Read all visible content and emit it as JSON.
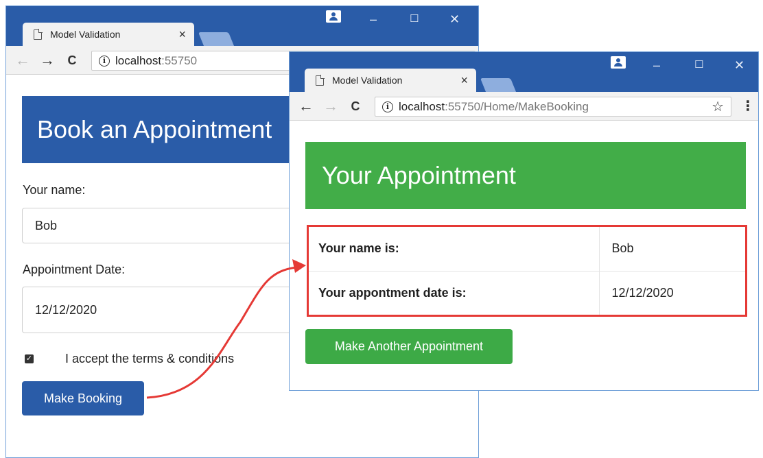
{
  "back_window": {
    "tab_title": "Model Validation",
    "tab_close": "×",
    "url_host": "localhost",
    "url_path": ":55750",
    "controls": {
      "minimize": "–",
      "maximize": "☐",
      "close": "✕"
    },
    "nav": {
      "back": "←",
      "forward": "→",
      "reload": "C"
    },
    "banner": "Book an Appointment",
    "form": {
      "name_label": "Your name:",
      "name_value": "Bob",
      "date_label": "Appointment Date:",
      "date_value": "12/12/2020",
      "terms_checked": true,
      "terms_label": "I accept the terms & conditions",
      "submit_label": "Make Booking"
    }
  },
  "front_window": {
    "tab_title": "Model Validation",
    "tab_close": "×",
    "url_host": "localhost",
    "url_path": ":55750/Home/MakeBooking",
    "controls": {
      "minimize": "–",
      "maximize": "☐",
      "close": "✕"
    },
    "nav": {
      "back": "←",
      "forward": "→",
      "reload": "C"
    },
    "banner": "Your Appointment",
    "summary": [
      {
        "label": "Your name is:",
        "value": "Bob"
      },
      {
        "label": "Your appontment date is:",
        "value": "12/12/2020"
      }
    ],
    "again_label": "Make Another Appointment"
  },
  "colors": {
    "chrome_blue": "#2a5ca8",
    "banner_green": "#42ad48",
    "button_green": "#3daa46",
    "highlight_red": "#e53935"
  },
  "icons": [
    "page-icon",
    "info-icon",
    "star-icon",
    "menu-icon",
    "profile-icon",
    "check-icon"
  ]
}
